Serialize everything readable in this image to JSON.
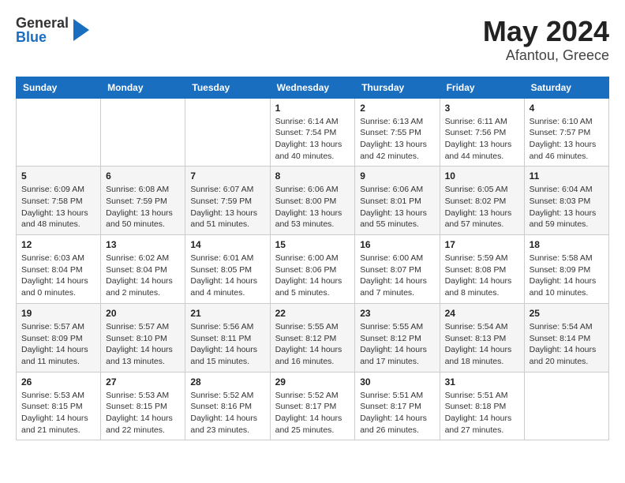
{
  "header": {
    "logo_general": "General",
    "logo_blue": "Blue",
    "title": "May 2024",
    "location": "Afantou, Greece"
  },
  "days_of_week": [
    "Sunday",
    "Monday",
    "Tuesday",
    "Wednesday",
    "Thursday",
    "Friday",
    "Saturday"
  ],
  "weeks": [
    [
      {
        "day": "",
        "info": ""
      },
      {
        "day": "",
        "info": ""
      },
      {
        "day": "",
        "info": ""
      },
      {
        "day": "1",
        "info": "Sunrise: 6:14 AM\nSunset: 7:54 PM\nDaylight: 13 hours\nand 40 minutes."
      },
      {
        "day": "2",
        "info": "Sunrise: 6:13 AM\nSunset: 7:55 PM\nDaylight: 13 hours\nand 42 minutes."
      },
      {
        "day": "3",
        "info": "Sunrise: 6:11 AM\nSunset: 7:56 PM\nDaylight: 13 hours\nand 44 minutes."
      },
      {
        "day": "4",
        "info": "Sunrise: 6:10 AM\nSunset: 7:57 PM\nDaylight: 13 hours\nand 46 minutes."
      }
    ],
    [
      {
        "day": "5",
        "info": "Sunrise: 6:09 AM\nSunset: 7:58 PM\nDaylight: 13 hours\nand 48 minutes."
      },
      {
        "day": "6",
        "info": "Sunrise: 6:08 AM\nSunset: 7:59 PM\nDaylight: 13 hours\nand 50 minutes."
      },
      {
        "day": "7",
        "info": "Sunrise: 6:07 AM\nSunset: 7:59 PM\nDaylight: 13 hours\nand 51 minutes."
      },
      {
        "day": "8",
        "info": "Sunrise: 6:06 AM\nSunset: 8:00 PM\nDaylight: 13 hours\nand 53 minutes."
      },
      {
        "day": "9",
        "info": "Sunrise: 6:06 AM\nSunset: 8:01 PM\nDaylight: 13 hours\nand 55 minutes."
      },
      {
        "day": "10",
        "info": "Sunrise: 6:05 AM\nSunset: 8:02 PM\nDaylight: 13 hours\nand 57 minutes."
      },
      {
        "day": "11",
        "info": "Sunrise: 6:04 AM\nSunset: 8:03 PM\nDaylight: 13 hours\nand 59 minutes."
      }
    ],
    [
      {
        "day": "12",
        "info": "Sunrise: 6:03 AM\nSunset: 8:04 PM\nDaylight: 14 hours\nand 0 minutes."
      },
      {
        "day": "13",
        "info": "Sunrise: 6:02 AM\nSunset: 8:04 PM\nDaylight: 14 hours\nand 2 minutes."
      },
      {
        "day": "14",
        "info": "Sunrise: 6:01 AM\nSunset: 8:05 PM\nDaylight: 14 hours\nand 4 minutes."
      },
      {
        "day": "15",
        "info": "Sunrise: 6:00 AM\nSunset: 8:06 PM\nDaylight: 14 hours\nand 5 minutes."
      },
      {
        "day": "16",
        "info": "Sunrise: 6:00 AM\nSunset: 8:07 PM\nDaylight: 14 hours\nand 7 minutes."
      },
      {
        "day": "17",
        "info": "Sunrise: 5:59 AM\nSunset: 8:08 PM\nDaylight: 14 hours\nand 8 minutes."
      },
      {
        "day": "18",
        "info": "Sunrise: 5:58 AM\nSunset: 8:09 PM\nDaylight: 14 hours\nand 10 minutes."
      }
    ],
    [
      {
        "day": "19",
        "info": "Sunrise: 5:57 AM\nSunset: 8:09 PM\nDaylight: 14 hours\nand 11 minutes."
      },
      {
        "day": "20",
        "info": "Sunrise: 5:57 AM\nSunset: 8:10 PM\nDaylight: 14 hours\nand 13 minutes."
      },
      {
        "day": "21",
        "info": "Sunrise: 5:56 AM\nSunset: 8:11 PM\nDaylight: 14 hours\nand 15 minutes."
      },
      {
        "day": "22",
        "info": "Sunrise: 5:55 AM\nSunset: 8:12 PM\nDaylight: 14 hours\nand 16 minutes."
      },
      {
        "day": "23",
        "info": "Sunrise: 5:55 AM\nSunset: 8:12 PM\nDaylight: 14 hours\nand 17 minutes."
      },
      {
        "day": "24",
        "info": "Sunrise: 5:54 AM\nSunset: 8:13 PM\nDaylight: 14 hours\nand 18 minutes."
      },
      {
        "day": "25",
        "info": "Sunrise: 5:54 AM\nSunset: 8:14 PM\nDaylight: 14 hours\nand 20 minutes."
      }
    ],
    [
      {
        "day": "26",
        "info": "Sunrise: 5:53 AM\nSunset: 8:15 PM\nDaylight: 14 hours\nand 21 minutes."
      },
      {
        "day": "27",
        "info": "Sunrise: 5:53 AM\nSunset: 8:15 PM\nDaylight: 14 hours\nand 22 minutes."
      },
      {
        "day": "28",
        "info": "Sunrise: 5:52 AM\nSunset: 8:16 PM\nDaylight: 14 hours\nand 23 minutes."
      },
      {
        "day": "29",
        "info": "Sunrise: 5:52 AM\nSunset: 8:17 PM\nDaylight: 14 hours\nand 25 minutes."
      },
      {
        "day": "30",
        "info": "Sunrise: 5:51 AM\nSunset: 8:17 PM\nDaylight: 14 hours\nand 26 minutes."
      },
      {
        "day": "31",
        "info": "Sunrise: 5:51 AM\nSunset: 8:18 PM\nDaylight: 14 hours\nand 27 minutes."
      },
      {
        "day": "",
        "info": ""
      }
    ]
  ]
}
